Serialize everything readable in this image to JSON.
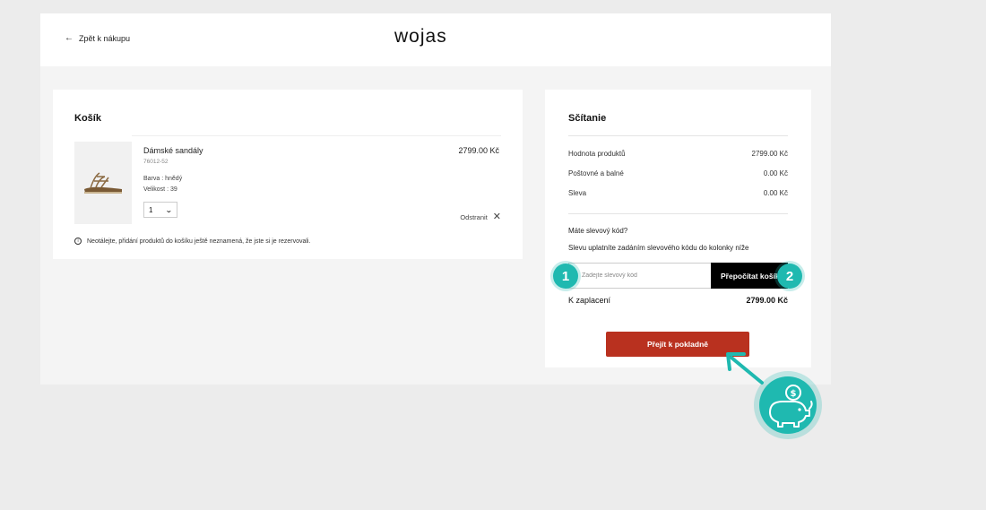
{
  "header": {
    "back_label": "Zpět k nákupu",
    "logo": "wojas"
  },
  "cart": {
    "title": "Košík",
    "item": {
      "name": "Dámské sandály",
      "code": "76012-52",
      "color_label": "Barva : hnědý",
      "size_label": "Velikost : 39",
      "price": "2799.00 Kč",
      "quantity": "1",
      "remove_label": "Odstranit"
    },
    "notice": "Neotálejte, přidání produktů do košíku ještě neznamená, že jste si je rezervovali."
  },
  "summary": {
    "title": "Sčítanie",
    "rows": [
      {
        "label": "Hodnota produktů",
        "value": "2799.00 Kč"
      },
      {
        "label": "Poštovné a balné",
        "value": "0.00 Kč"
      },
      {
        "label": "Sleva",
        "value": "0.00 Kč"
      }
    ],
    "promo_question": "Máte slevový kód?",
    "promo_hint": "Slevu uplatníte zadáním slevového kódu do kolonky níže",
    "promo_placeholder": "Zadejte slevový kód",
    "recalc_label": "Přepočítat košík",
    "total_label": "K zaplacení",
    "total_value": "2799.00 Kč",
    "checkout_label": "Přejít k pokladně"
  },
  "overlay": {
    "badge_1": "1",
    "badge_2": "2",
    "accent_color": "#1fb9b0",
    "icon": "piggy-bank-coin-icon"
  }
}
